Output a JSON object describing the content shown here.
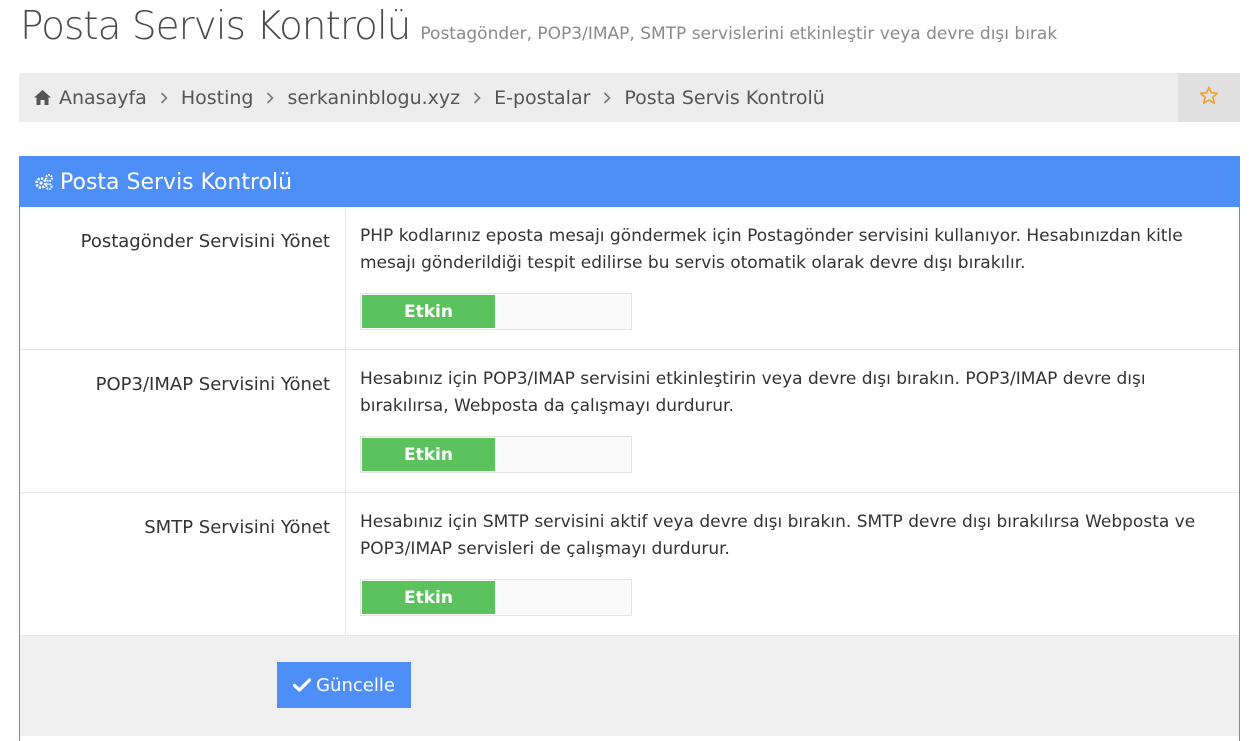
{
  "header": {
    "title": "Posta Servis Kontrolü",
    "subtitle": "Postagönder, POP3/IMAP, SMTP servislerini etkinleştir veya devre dışı bırak"
  },
  "breadcrumb": {
    "home_icon": "home-icon",
    "separator_icon": "chevron-right-icon",
    "items": [
      "Anasayfa",
      "Hosting",
      "serkaninblogu.xyz",
      "E-postalar",
      "Posta Servis Kontrolü"
    ],
    "favorite_icon": "star-outline-icon"
  },
  "panel": {
    "icon": "gears-icon",
    "title": "Posta Servis Kontrolü",
    "rows": [
      {
        "label": "Postagönder Servisini Yönet",
        "description": "PHP kodlarınız eposta mesajı göndermek için Postagönder servisini kullanıyor. Hesabınızdan kitle mesajı gönderildiği tespit edilirse bu servis otomatik olarak devre dışı bırakılır.",
        "toggle_label": "Etkin"
      },
      {
        "label": "POP3/IMAP Servisini Yönet",
        "description": "Hesabınız için POP3/IMAP servisini etkinleştirin veya devre dışı bırakın. POP3/IMAP devre dışı bırakılırsa, Webposta da çalışmayı durdurur.",
        "toggle_label": "Etkin"
      },
      {
        "label": "SMTP Servisini Yönet",
        "description": "Hesabınız için SMTP servisini aktif veya devre dışı bırakın. SMTP devre dışı bırakılırsa Webposta ve POP3/IMAP servisleri de çalışmayı durdurur.",
        "toggle_label": "Etkin"
      }
    ],
    "submit_label": "Güncelle",
    "submit_icon": "check-icon"
  },
  "colors": {
    "accent": "#4e8ff7",
    "toggle_on": "#5cc25e",
    "breadcrumb_bg": "#ededed",
    "star": "#f0a030"
  }
}
